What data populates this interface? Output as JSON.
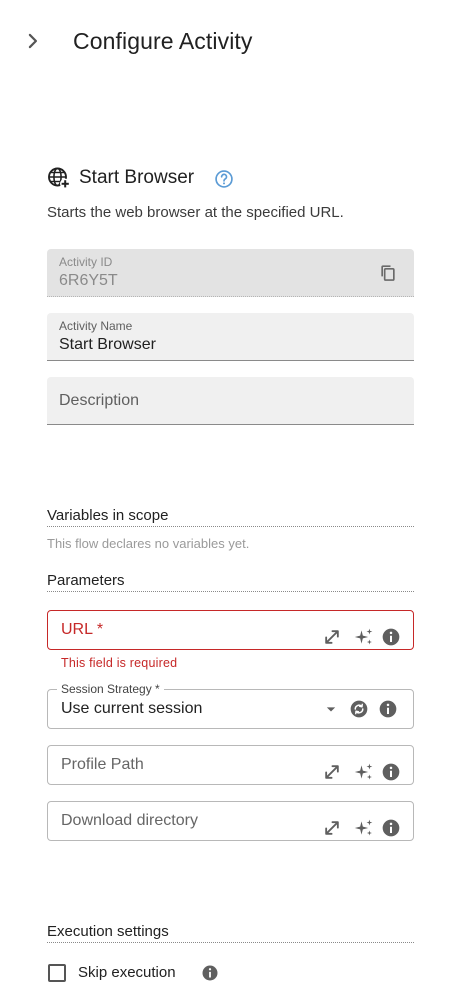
{
  "header": {
    "title": "Configure Activity"
  },
  "activity": {
    "title": "Start Browser",
    "description": "Starts the web browser at the specified URL."
  },
  "fields": {
    "activity_id": {
      "label": "Activity ID",
      "value": "6R6Y5T"
    },
    "activity_name": {
      "label": "Activity Name",
      "value": "Start Browser"
    },
    "description": {
      "placeholder": "Description"
    }
  },
  "variables": {
    "heading": "Variables in scope",
    "note": "This flow declares no variables yet."
  },
  "parameters": {
    "heading": "Parameters",
    "url": {
      "label": "URL *",
      "error": "This field is required"
    },
    "session_strategy": {
      "label": "Session Strategy *",
      "value": "Use current session"
    },
    "profile_path": {
      "placeholder": "Profile Path"
    },
    "download_directory": {
      "placeholder": "Download directory"
    }
  },
  "execution": {
    "heading": "Execution settings",
    "skip_label": "Skip execution",
    "skip_checked": false
  },
  "colors": {
    "error": "#c62828",
    "help_accent": "#5b9bd5",
    "icon_gray": "#5f5f5f"
  }
}
